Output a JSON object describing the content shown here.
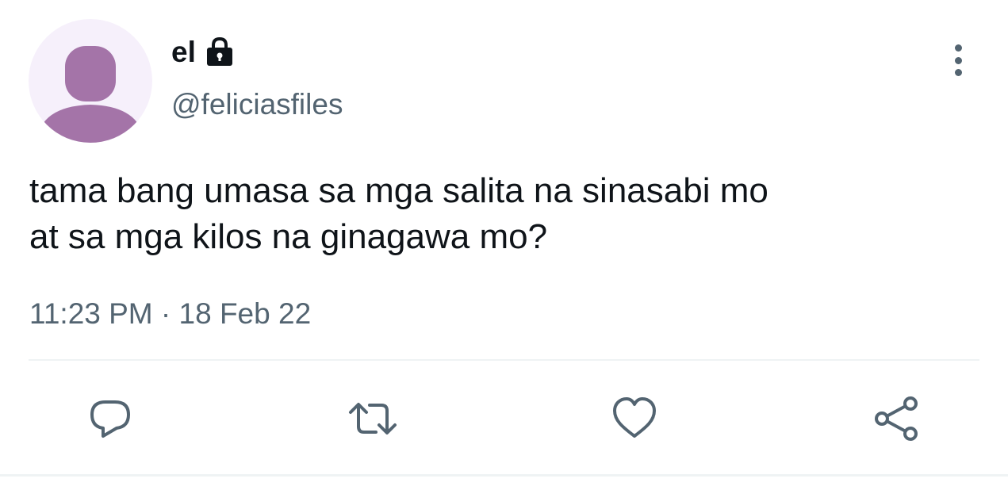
{
  "tweet": {
    "author": {
      "display_name": "el",
      "handle": "@feliciasfiles",
      "avatar_icon": "default-profile-silhouette",
      "protected_icon": "lock-icon"
    },
    "text_lines": [
      "tama bang umasa sa mga salita na sinasabi mo",
      "at sa mga kilos na ginagawa mo?"
    ],
    "time": "11:23 PM",
    "separator": " · ",
    "date": "18 Feb 22",
    "actions": [
      "reply-icon",
      "retweet-icon",
      "like-icon",
      "share-icon"
    ],
    "more_icon": "more-vertical-icon"
  },
  "colors": {
    "text_primary": "#0f1419",
    "text_secondary": "#536471",
    "avatar_bg": "#f6f0fb",
    "avatar_silhouette": "#a474a8",
    "divider": "#eff3f4"
  }
}
